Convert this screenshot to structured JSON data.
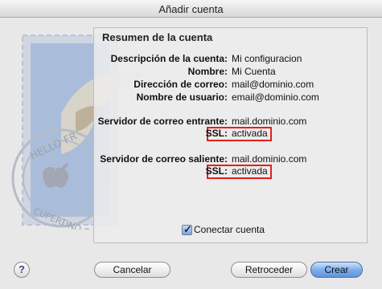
{
  "window": {
    "title": "Añadir cuenta"
  },
  "summary": {
    "heading": "Resumen de la cuenta",
    "rows": [
      {
        "label": "Descripción de la cuenta:",
        "value": "Mi configuracion"
      },
      {
        "label": "Nombre:",
        "value": "Mi Cuenta"
      },
      {
        "label": "Dirección de correo:",
        "value": "mail@dominio.com"
      },
      {
        "label": "Nombre de usuario:",
        "value": "email@dominio.com"
      }
    ],
    "incoming": {
      "label": "Servidor de correo entrante:",
      "value": "mail.dominio.com",
      "ssl_label": "SSL:",
      "ssl_value": "activada"
    },
    "outgoing": {
      "label": "Servidor de correo saliente:",
      "value": "mail.dominio.com",
      "ssl_label": "SSL:",
      "ssl_value": "activada"
    }
  },
  "connect_checkbox": {
    "label": "Conectar cuenta",
    "checked": true,
    "mark": "✓"
  },
  "stamp": {
    "line1": "HELLO FR",
    "line2": "CUPERTINO CA"
  },
  "buttons": {
    "help": "?",
    "cancel": "Cancelar",
    "back": "Retroceder",
    "create": "Crear"
  },
  "colors": {
    "highlight": "#e2201b",
    "primary_button": "#5f95df"
  }
}
